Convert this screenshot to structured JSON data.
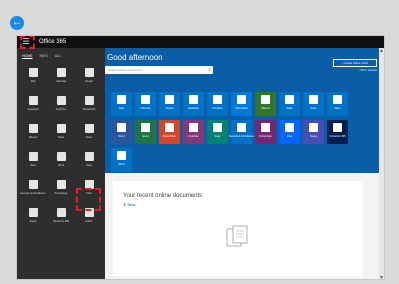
{
  "back_glyph": "←",
  "header": {
    "app_title": "Office 365",
    "menu_glyph": "☰"
  },
  "nav": {
    "tabs": [
      {
        "label": "HOME",
        "active": true
      },
      {
        "label": "INFO",
        "active": false
      },
      {
        "label": "ALL",
        "active": false
      }
    ],
    "rows": [
      [
        {
          "label": "Mail",
          "icon": "mail-icon"
        },
        {
          "label": "Calendar",
          "icon": "calendar-icon"
        },
        {
          "label": "People",
          "icon": "people-icon"
        }
      ],
      [
        {
          "label": "Newsfeed",
          "icon": "newsfeed-icon"
        },
        {
          "label": "OneDrive",
          "icon": "onedrive-icon"
        },
        {
          "label": "SharePoint",
          "icon": "sharepoint-icon"
        }
      ],
      [
        {
          "label": "Planner",
          "icon": "planner-icon"
        },
        {
          "label": "Tasks",
          "icon": "tasks-icon"
        },
        {
          "label": "Delve",
          "icon": "delve-icon"
        }
      ],
      [
        {
          "label": "Video",
          "icon": "video-icon"
        },
        {
          "label": "Word",
          "icon": "word-icon"
        },
        {
          "label": "Sway",
          "icon": "sway-icon"
        }
      ],
      [
        {
          "label": "Security & Compliance",
          "icon": "security-icon"
        },
        {
          "label": "PowerApps",
          "icon": "powerapps-icon"
        },
        {
          "label": "Flow",
          "icon": "flow-icon"
        }
      ],
      [
        {
          "label": "Teams",
          "icon": "teams-icon"
        },
        {
          "label": "Dynamics 365",
          "icon": "dynamics-icon"
        },
        {
          "label": "Admin",
          "icon": "admin-icon"
        }
      ]
    ]
  },
  "main": {
    "greeting": "Good afternoon",
    "search_placeholder": "Search online documents",
    "install_button": "⤓ Install Office 2016",
    "other_installs": "Other installs",
    "tile_rows": [
      [
        {
          "label": "Mail",
          "color": "#0072c6"
        },
        {
          "label": "Calendar",
          "color": "#0072c6"
        },
        {
          "label": "People",
          "color": "#0072c6"
        },
        {
          "label": "Newsfeed",
          "color": "#0072c6"
        },
        {
          "label": "OneDrive",
          "color": "#0072c6"
        },
        {
          "label": "SharePoint",
          "color": "#0078d7"
        },
        {
          "label": "Planner",
          "color": "#31752f"
        },
        {
          "label": "Tasks",
          "color": "#0072c6"
        },
        {
          "label": "Delve",
          "color": "#0072c6"
        },
        {
          "label": "Video",
          "color": "#0072c6"
        }
      ],
      [
        {
          "label": "Word",
          "color": "#2b579a"
        },
        {
          "label": "Excel",
          "color": "#217346"
        },
        {
          "label": "PowerPoint",
          "color": "#d24726"
        },
        {
          "label": "OneNote",
          "color": "#80397b"
        },
        {
          "label": "Sway",
          "color": "#008272"
        },
        {
          "label": "Security & Compliance",
          "color": "#0072c6"
        },
        {
          "label": "PowerApps",
          "color": "#742774"
        },
        {
          "label": "Flow",
          "color": "#0066ff"
        },
        {
          "label": "Teams",
          "color": "#464eb8"
        },
        {
          "label": "Dynamics 365",
          "color": "#002050"
        }
      ],
      [
        {
          "label": "Admin",
          "color": "#0072c6"
        }
      ]
    ],
    "recent_title": "Your recent online documents",
    "new_link": "⊕ New"
  },
  "colors": {
    "accent": "#0a5ea8",
    "highlight": "#e51c23"
  }
}
